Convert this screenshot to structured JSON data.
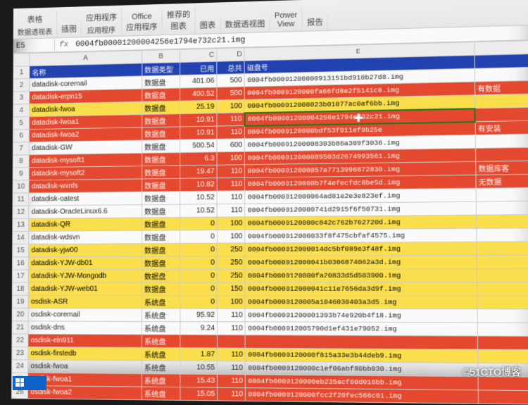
{
  "ribbon": {
    "groups": [
      {
        "label": "表格",
        "sub": "数据透视表"
      },
      {
        "label": "插图"
      },
      {
        "label": "应用程序",
        "sub": "应用程序"
      },
      {
        "label": "Office\n应用程序"
      },
      {
        "label": "推荐的\n图表"
      },
      {
        "label": "图表"
      },
      {
        "label": "数据透视图"
      },
      {
        "label": "Power\nView"
      },
      {
        "label": "报告"
      }
    ]
  },
  "formula_bar": {
    "cell_ref": "E5",
    "fx": "fx",
    "content": "0004fb00001200004256e1794e732c21.img"
  },
  "columns": [
    "",
    "A",
    "B",
    "C",
    "D",
    "E",
    ""
  ],
  "header_row": {
    "A": "名称",
    "B": "数据类型",
    "C": "已用",
    "D": "总共",
    "E": "磁盘号"
  },
  "rows": [
    {
      "n": "2",
      "A": "datadisk-coremail",
      "B": "数据盘",
      "C": "401.06",
      "D": "500",
      "E": "0004fb00001200000913151bd910b27d8.img",
      "fill": ""
    },
    {
      "n": "3",
      "A": "datadisk-erpn15",
      "B": "数据盘",
      "C": "400.52",
      "D": "500",
      "E": "0004fb0000120000fa66fd8e2f5141c8.img",
      "F": "有数据",
      "fill": "red"
    },
    {
      "n": "4",
      "A": "datadisk-fwoa",
      "B": "数据盘",
      "C": "25.19",
      "D": "100",
      "E": "0004fb000012000023b01077ac0af6bb.img",
      "fill": "yellow"
    },
    {
      "n": "5",
      "A": "datadisk-fwoa1",
      "B": "数据盘",
      "C": "10.91",
      "D": "110",
      "E": "0004fb00001200004256e1794e732c21.img",
      "fill": "red",
      "selectedE": true
    },
    {
      "n": "6",
      "A": "datadisk-fwoa2",
      "B": "数据盘",
      "C": "10.91",
      "D": "110",
      "E": "0004fb0000120000bdf53f911ef9b25e",
      "F": "有安装",
      "fill": "red"
    },
    {
      "n": "7",
      "A": "datadisk-GW",
      "B": "数据盘",
      "C": "500.54",
      "D": "600",
      "E": "0004fb00001200008303b86a309f3036.img",
      "fill": ""
    },
    {
      "n": "8",
      "A": "datadisk-mysoft1",
      "B": "数据盘",
      "C": "6.3",
      "D": "100",
      "E": "0004fb000012000089503d2674993561.img",
      "fill": "red"
    },
    {
      "n": "9",
      "A": "datadisk-mysoft2",
      "B": "数据盘",
      "C": "19.47",
      "D": "110",
      "E": "0004fb000012000057a7713996872830.img",
      "F": "数据库客",
      "fill": "red"
    },
    {
      "n": "10",
      "A": "datadisk-wxnfs",
      "B": "数据盘",
      "C": "10.82",
      "D": "110",
      "E": "0004fb0000120000b7f4efecfdc8be5d.img",
      "F": "无数据",
      "fill": "red"
    },
    {
      "n": "11",
      "A": "datadisk-oatest",
      "B": "数据盘",
      "C": "10.52",
      "D": "110",
      "E": "0004fb000012000064ad81e2e3e823ef.img",
      "fill": ""
    },
    {
      "n": "12",
      "A": "datadisk-OracleLinux6.6",
      "B": "数据盘",
      "C": "10.52",
      "D": "110",
      "E": "0004fb0000120000741d2915f6f50731.img",
      "fill": ""
    },
    {
      "n": "13",
      "A": "datadisk-QR",
      "B": "数据盘",
      "C": "0",
      "D": "100",
      "E": "0004fb0000120000c842c762b762720d.img",
      "fill": "yellow"
    },
    {
      "n": "14",
      "A": "datadisk-wdsvn",
      "B": "数据盘",
      "C": "0",
      "D": "100",
      "E": "0004fb000012000033f8f475cbfaf4575.img",
      "fill": ""
    },
    {
      "n": "15",
      "A": "datadisk-yjw00",
      "B": "数据盘",
      "C": "0",
      "D": "250",
      "E": "0004fb000012000014dc5bf089e3f48f.img",
      "fill": "yellow"
    },
    {
      "n": "16",
      "A": "datadisk-YJW-db01",
      "B": "数据盘",
      "C": "0",
      "D": "250",
      "E": "0004fb000012000041b0306874062a3d.img",
      "fill": "yellow"
    },
    {
      "n": "17",
      "A": "datadisk-YJW-Mongodb",
      "B": "数据盘",
      "C": "0",
      "D": "250",
      "E": "0004fb0000120000fa20833d5d503900.img",
      "fill": "yellow"
    },
    {
      "n": "18",
      "A": "datadisk-YJW-web01",
      "B": "数据盘",
      "C": "0",
      "D": "150",
      "E": "0004fb000012000041c11e7656da3d9f.img",
      "fill": "yellow"
    },
    {
      "n": "19",
      "A": "osdisk-ASR",
      "B": "系统盘",
      "C": "0",
      "D": "100",
      "E": "0004fb0000120005a1046030403a3d5.img",
      "fill": "yellow"
    },
    {
      "n": "20",
      "A": "osdisk-coremail",
      "B": "系统盘",
      "C": "95.92",
      "D": "110",
      "E": "0004fb00001200001393b74e920b4f18.img",
      "fill": ""
    },
    {
      "n": "21",
      "A": "osdisk-dns",
      "B": "系统盘",
      "C": "9.24",
      "D": "110",
      "E": "0004fb000012005790d1ef431e79052.img",
      "fill": ""
    },
    {
      "n": "22",
      "A": "osdisk-eln911",
      "B": "系统盘",
      "C": "",
      "D": "",
      "E": "",
      "fill": "red"
    },
    {
      "n": "23",
      "A": "osdisk-firstedb",
      "B": "系统盘",
      "C": "1.87",
      "D": "110",
      "E": "0004fb0000120000f815a33e3b44deb9.img",
      "fill": "yellow"
    },
    {
      "n": "24",
      "A": "osdisk-fwoa",
      "B": "系统盘",
      "C": "10.55",
      "D": "110",
      "E": "0004fb0000120000c1ef06abf80bb030.img",
      "fill": ""
    },
    {
      "n": "25",
      "A": "osdisk-fwoa1",
      "B": "系统盘",
      "C": "15.43",
      "D": "110",
      "E": "0004fb0000120000eb235acf60d016bb.img",
      "fill": "red"
    },
    {
      "n": "26",
      "A": "osdisk-fwoa2",
      "B": "系统盘",
      "C": "15.05",
      "D": "110",
      "E": "0004fb0000120000fcc2f20fec566c61.img",
      "fill": "red"
    }
  ],
  "watermark": "©51CTO博客"
}
